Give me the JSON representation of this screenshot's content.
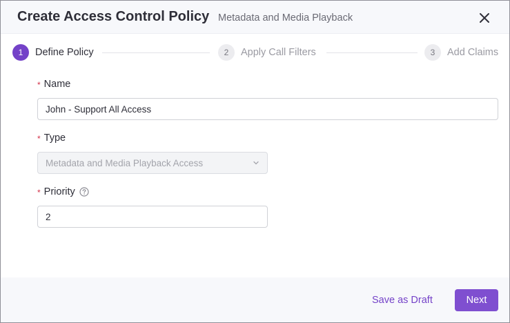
{
  "dialog": {
    "title": "Create Access Control Policy",
    "subtitle": "Metadata and Media Playback",
    "close_icon": "close-icon"
  },
  "steps": [
    {
      "number": "1",
      "label": "Define Policy",
      "state": "active"
    },
    {
      "number": "2",
      "label": "Apply Call Filters",
      "state": "inactive"
    },
    {
      "number": "3",
      "label": "Add Claims",
      "state": "inactive"
    }
  ],
  "form": {
    "name": {
      "required_mark": "*",
      "label": "Name",
      "value": "John - Support All Access"
    },
    "type": {
      "required_mark": "*",
      "label": "Type",
      "value": "Metadata and Media Playback Access",
      "disabled": true,
      "icon": "chevron-down-icon"
    },
    "priority": {
      "required_mark": "*",
      "label": "Priority",
      "value": "2",
      "help_icon": "question-circle-icon"
    }
  },
  "footer": {
    "save_draft_label": "Save as Draft",
    "next_label": "Next"
  },
  "colors": {
    "accent": "#7442c8",
    "required": "#d3334a",
    "header_bg": "#f7f8fb"
  }
}
